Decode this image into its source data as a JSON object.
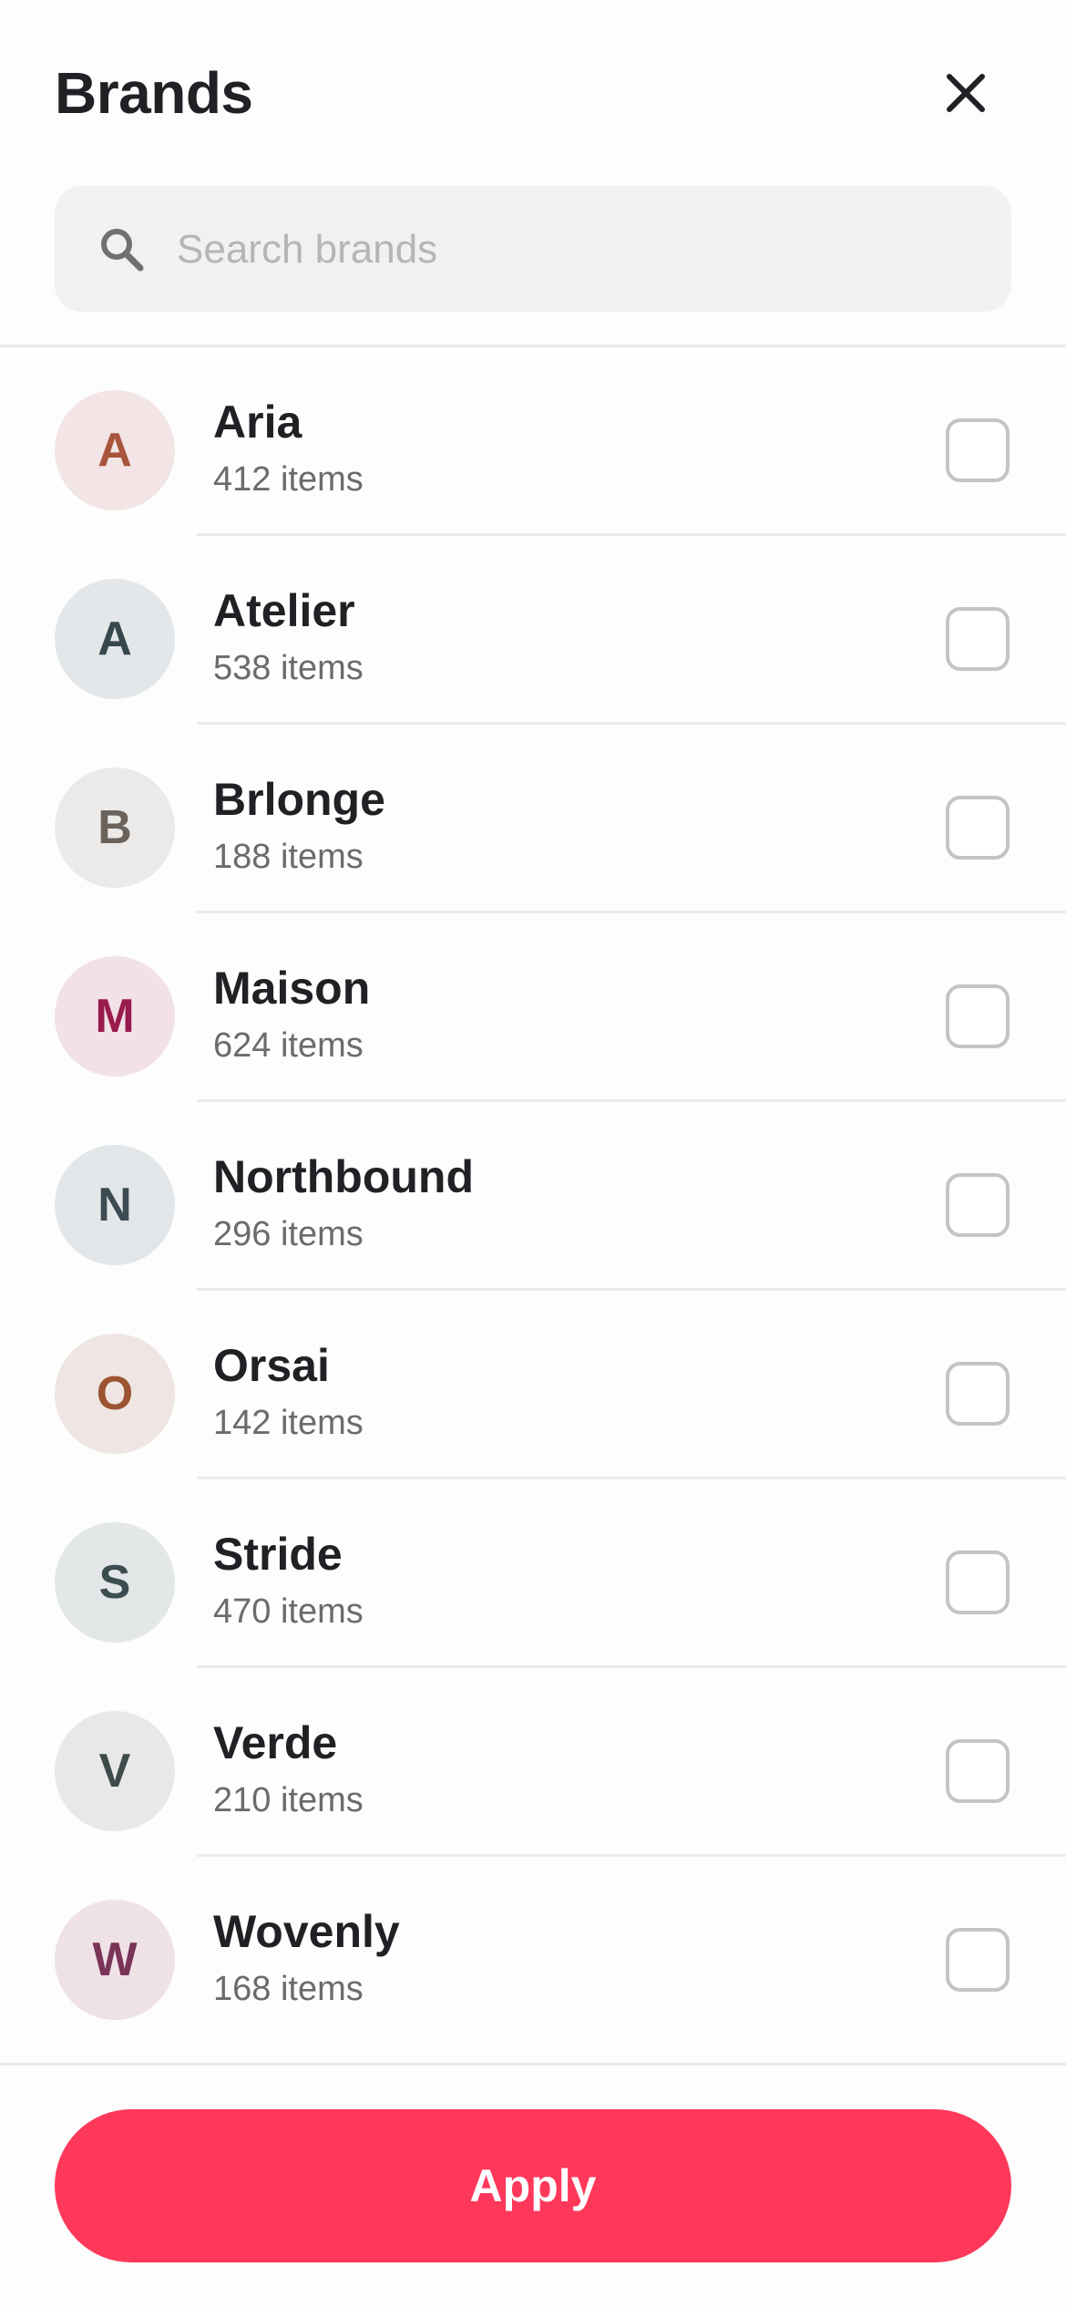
{
  "header": {
    "title": "Brands"
  },
  "search": {
    "placeholder": "Search brands",
    "value": ""
  },
  "brands": [
    {
      "initial": "A",
      "name": "Aria",
      "count": "412 items",
      "bg": "#f3e4e6",
      "fg": "#a8553c",
      "checked": false
    },
    {
      "initial": "A",
      "name": "Atelier",
      "count": "538 items",
      "bg": "#e4e7e9",
      "fg": "#36474d",
      "checked": false
    },
    {
      "initial": "B",
      "name": "Brlonge",
      "count": "188 items",
      "bg": "#ebeae8",
      "fg": "#6b625c",
      "checked": false
    },
    {
      "initial": "M",
      "name": "Maison",
      "count": "624 items",
      "bg": "#f2e1e6",
      "fg": "#981b4c",
      "checked": false
    },
    {
      "initial": "N",
      "name": "Northbound",
      "count": "296 items",
      "bg": "#e3e6e9",
      "fg": "#3d4c52",
      "checked": false
    },
    {
      "initial": "O",
      "name": "Orsai",
      "count": "142 items",
      "bg": "#efe6e3",
      "fg": "#9c5433",
      "checked": false
    },
    {
      "initial": "S",
      "name": "Stride",
      "count": "470 items",
      "bg": "#e3e7e8",
      "fg": "#3b4d50",
      "checked": false
    },
    {
      "initial": "V",
      "name": "Verde",
      "count": "210 items",
      "bg": "#e7e8e7",
      "fg": "#3f4b4a",
      "checked": false
    },
    {
      "initial": "W",
      "name": "Wovenly",
      "count": "168 items",
      "bg": "#efe2e7",
      "fg": "#7a3458",
      "checked": false
    }
  ],
  "footer": {
    "apply_label": "Apply"
  },
  "colors": {
    "accent": "#fe385a",
    "text": "#202124",
    "secondary_text": "#6b6b6b",
    "search_bg": "#f1f1f1",
    "checkbox_border": "#c4c4c4"
  },
  "icons": {
    "close": "close-icon",
    "search": "search-icon"
  }
}
